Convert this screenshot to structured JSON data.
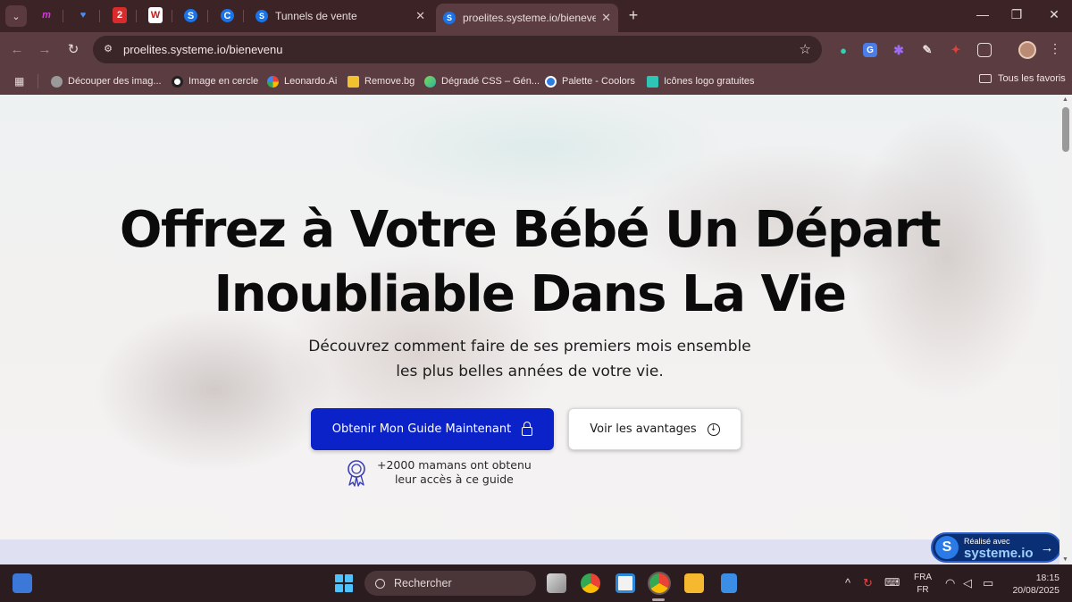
{
  "browser": {
    "tabs": [
      {
        "label": "Tunnels de vente",
        "active": false
      },
      {
        "label": "proelites.systeme.io/bienevenu",
        "active": true
      }
    ],
    "url": "proelites.systeme.io/bienevenu",
    "bookmarks": [
      {
        "label": "Découper des imag..."
      },
      {
        "label": "Image en cercle"
      },
      {
        "label": "Leonardo.Ai"
      },
      {
        "label": "Remove.bg"
      },
      {
        "label": "Dégradé CSS – Gén..."
      },
      {
        "label": "Palette - Coolors"
      },
      {
        "label": "Icônes logo gratuites"
      }
    ],
    "bookmarks_folder": "Tous les favoris"
  },
  "page": {
    "hero_title_line1": "Offrez à Votre Bébé Un Départ",
    "hero_title_line2": "Inoubliable Dans La Vie",
    "hero_subtitle_line1": "Découvrez comment faire de ses premiers mois ensemble",
    "hero_subtitle_line2": "les plus belles années de votre vie.",
    "primary_cta": "Obtenir Mon Guide Maintenant",
    "secondary_cta": "Voir les avantages",
    "social_proof_line1": "+2000 mamans ont obtenu",
    "social_proof_line2": "leur accès à ce guide",
    "made_with_small": "Réalisé avec",
    "made_with_brand": "systeme.io",
    "colors": {
      "primary": "#0b22c9",
      "hero_band": "#dfe0f2"
    }
  },
  "taskbar": {
    "search_placeholder": "Rechercher",
    "lang_top": "FRA",
    "lang_bottom": "FR",
    "time": "18:15",
    "date": "20/08/2025"
  }
}
